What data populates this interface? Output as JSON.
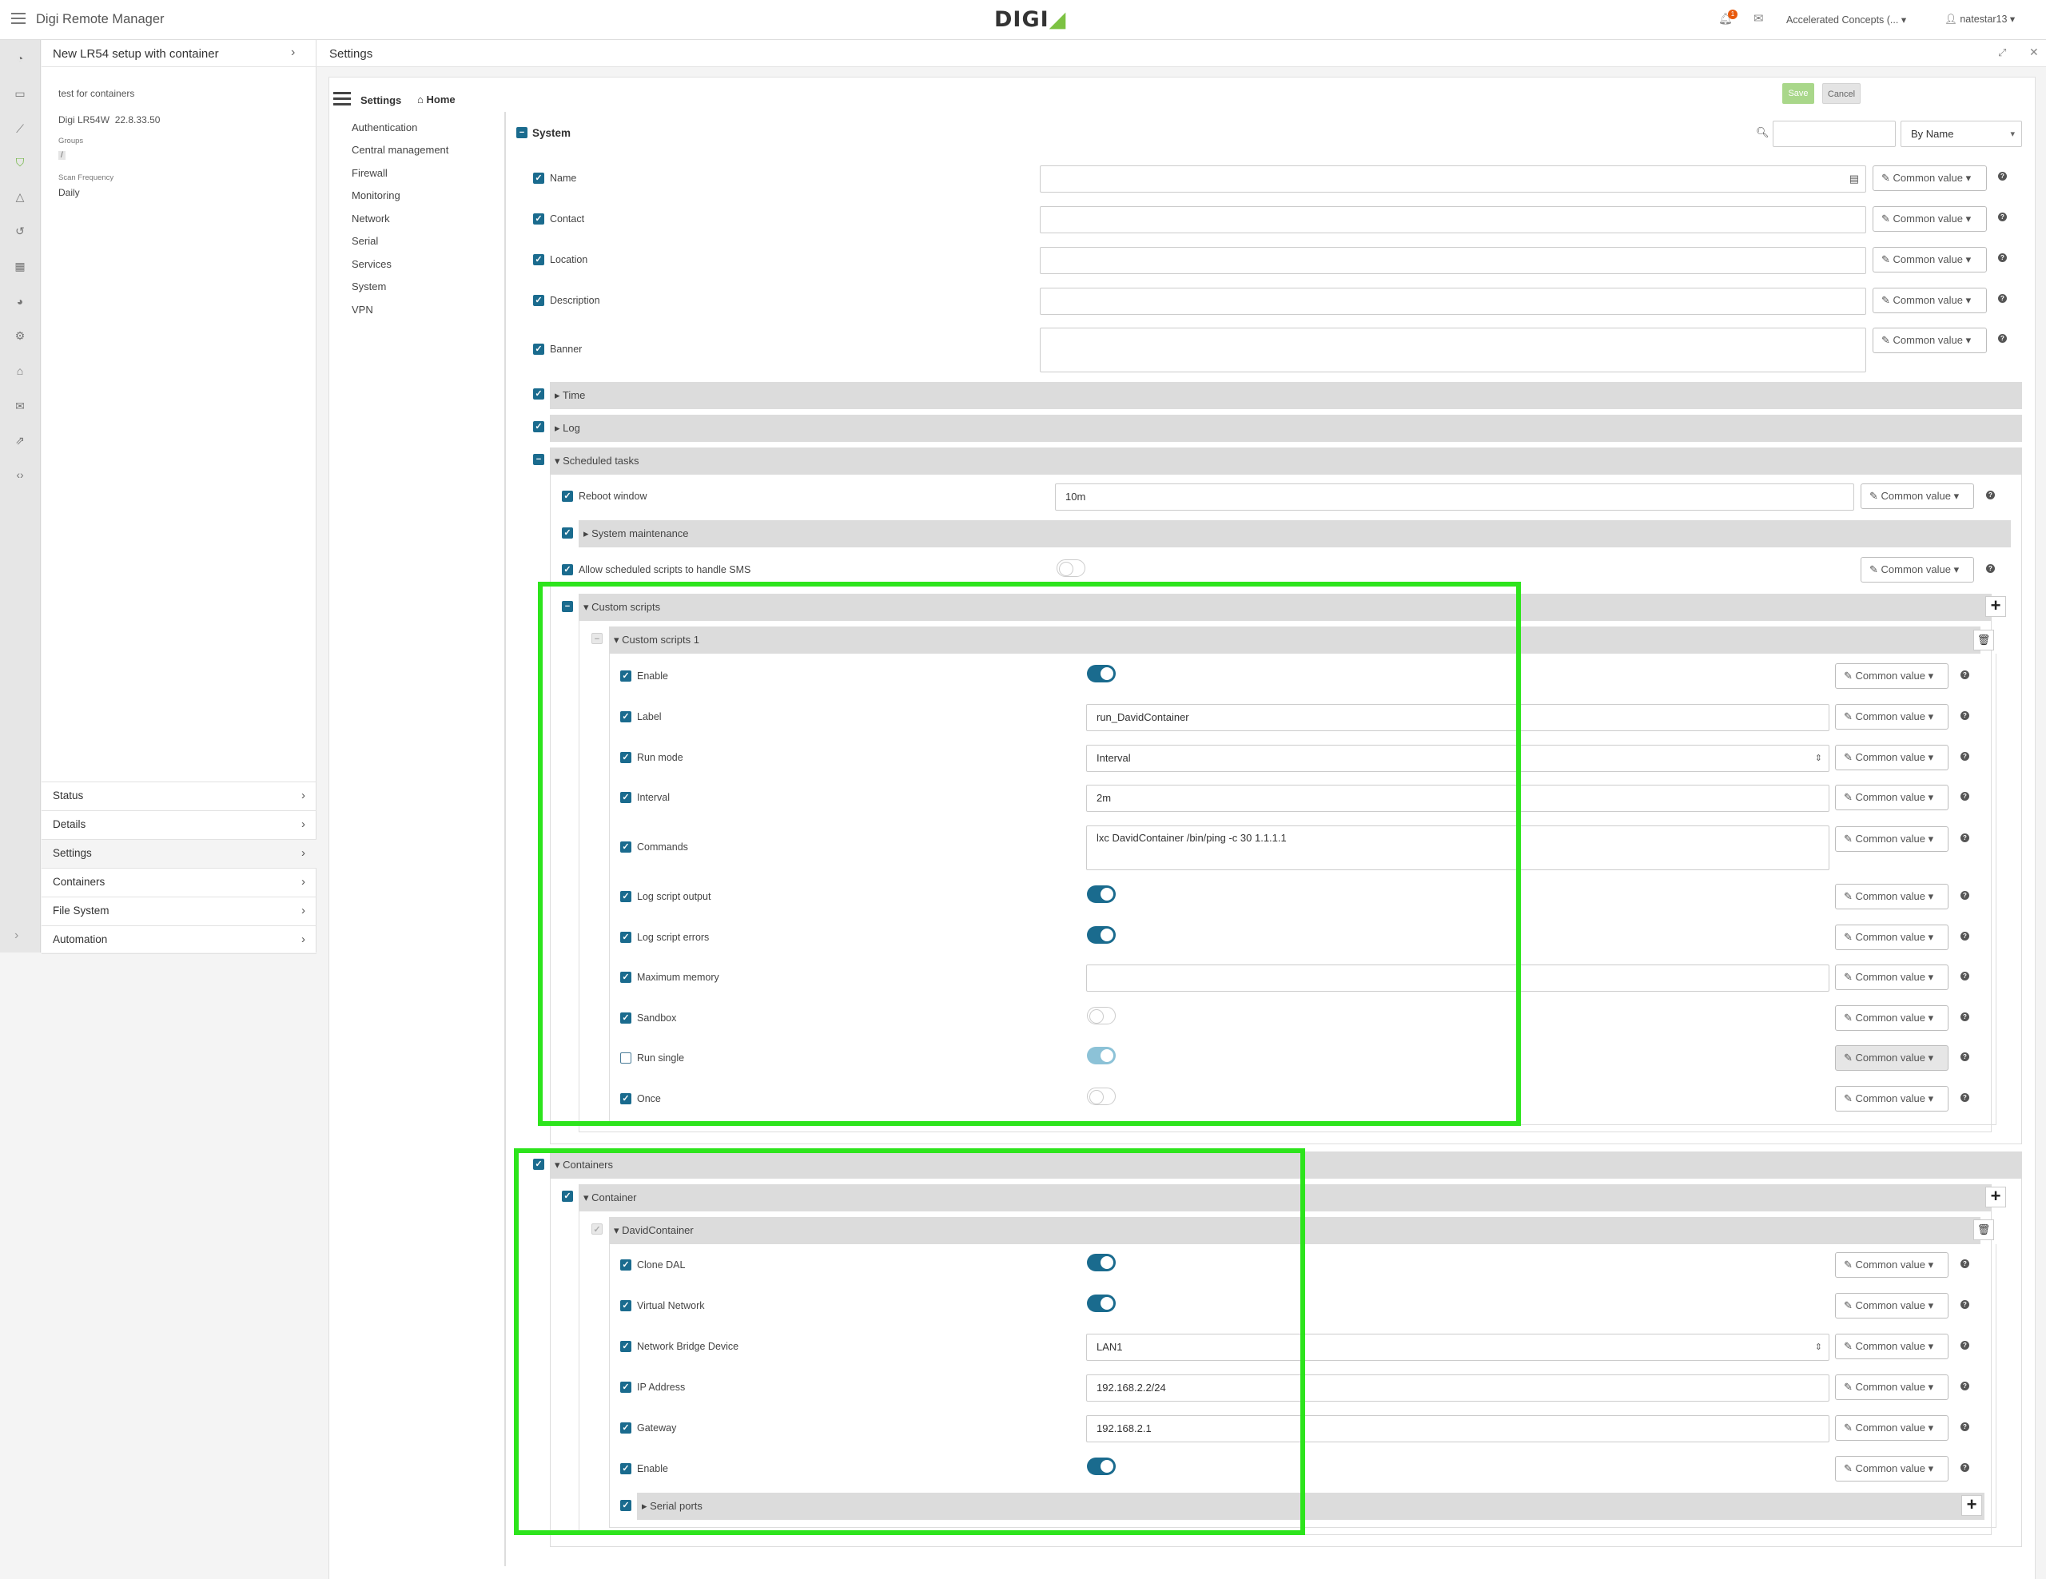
{
  "app": {
    "title": "Digi Remote Manager",
    "logo": "DIGI"
  },
  "topbar": {
    "notification_count": "1",
    "org": "Accelerated Concepts (...",
    "user": "natestar13"
  },
  "device": {
    "title": "New LR54 setup with container",
    "description": "test for containers",
    "model": "Digi LR54W",
    "firmware": "22.8.33.50",
    "groups_label": "Groups",
    "groups_value": "/",
    "scan_label": "Scan Frequency",
    "scan_value": "Daily"
  },
  "device_nav": [
    {
      "label": "Status"
    },
    {
      "label": "Details"
    },
    {
      "label": "Settings"
    },
    {
      "label": "Containers"
    },
    {
      "label": "File System"
    },
    {
      "label": "Automation"
    }
  ],
  "page": {
    "title": "Settings"
  },
  "breadcrumb": {
    "settings": "Settings",
    "home": "Home"
  },
  "actions": {
    "save": "Save",
    "cancel": "Cancel"
  },
  "settings_nav": [
    "Authentication",
    "Central management",
    "Firewall",
    "Monitoring",
    "Network",
    "Serial",
    "Services",
    "System",
    "VPN"
  ],
  "system": {
    "title": "System",
    "sort": "By Name",
    "common": "Common value",
    "fields": {
      "name": "Name",
      "contact": "Contact",
      "location": "Location",
      "description": "Description",
      "banner": "Banner"
    },
    "time": "Time",
    "log": "Log",
    "scheduled": "Scheduled tasks",
    "reboot_label": "Reboot window",
    "reboot_value": "10m",
    "sysmaint": "System maintenance",
    "allow_sms": "Allow scheduled scripts to handle SMS",
    "custom_scripts": "Custom scripts",
    "custom_scripts_1": "Custom scripts 1",
    "script": {
      "enable": "Enable",
      "label": "Label",
      "label_value": "run_DavidContainer",
      "runmode": "Run mode",
      "runmode_value": "Interval",
      "interval": "Interval",
      "interval_value": "2m",
      "commands": "Commands",
      "commands_value": "lxc DavidContainer /bin/ping -c 30 1.1.1.1",
      "log_output": "Log script output",
      "log_errors": "Log script errors",
      "max_memory": "Maximum memory",
      "sandbox": "Sandbox",
      "run_single": "Run single",
      "once": "Once"
    },
    "containers": "Containers",
    "container": "Container",
    "david": "DavidContainer",
    "ctr": {
      "clone_dal": "Clone DAL",
      "virtual_net": "Virtual Network",
      "bridge": "Network Bridge Device",
      "bridge_value": "LAN1",
      "ip": "IP Address",
      "ip_value": "192.168.2.2/24",
      "gateway": "Gateway",
      "gateway_value": "192.168.2.1",
      "enable": "Enable",
      "serial": "Serial ports"
    }
  },
  "colors": {
    "accent": "#1a6b8e",
    "highlight": "#2de41c",
    "brand_green": "#7cc242"
  },
  "icons": [
    "menu-icon",
    "dashboard-icon",
    "inbox-icon",
    "chart-icon",
    "shield-icon",
    "bell-icon",
    "history-icon",
    "calendar-icon",
    "pie-icon",
    "gears-icon",
    "lock-icon",
    "envelope-icon",
    "external-link-icon",
    "code-icon"
  ]
}
